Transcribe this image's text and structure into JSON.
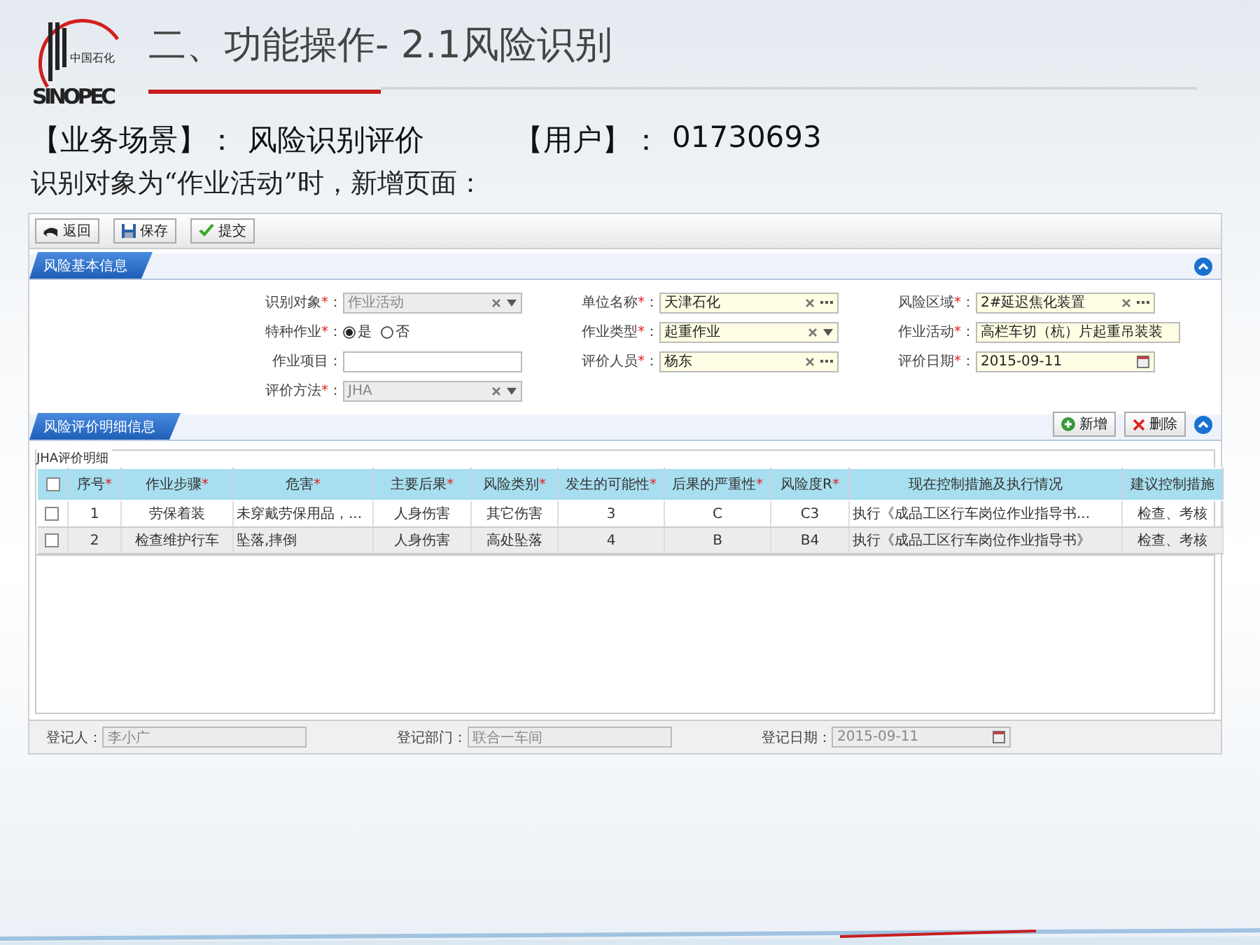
{
  "logo": {
    "text": "SINOPEC",
    "subtext": "中国石化"
  },
  "title": "二、功能操作- 2.1风险识别",
  "scenario": {
    "label": "【业务场景】",
    "sep": "：",
    "value": "风险识别评价",
    "user_label": "【用户】",
    "user_sep": "：",
    "user": "01730693"
  },
  "subtitle": "识别对象为“作业活动”时，新增页面：",
  "toolbar": [
    {
      "kind": "back",
      "label": "返回"
    },
    {
      "kind": "save",
      "label": "保存"
    },
    {
      "kind": "submit",
      "label": "提交"
    }
  ],
  "basic_panel": {
    "title": "风险基本信息",
    "expanded": true,
    "columns": [
      [
        {
          "label": "识别对象",
          "required_mark": "*",
          "colon": "：",
          "kind": "select",
          "value": "作业活动",
          "disabled": true
        },
        {
          "label": "特种作业",
          "required_mark": "*",
          "colon": "：",
          "kind": "radio",
          "options": [
            {
              "label": "是",
              "selected": true
            },
            {
              "label": "否",
              "selected": false
            }
          ]
        },
        {
          "label": "作业项目",
          "colon": "：",
          "kind": "text",
          "disabled": false
        },
        {
          "label": "评价方法",
          "required_mark": "*",
          "colon": "：",
          "kind": "select",
          "value": "JHA",
          "disabled": true
        }
      ],
      [
        {
          "label": "单位名称",
          "required_mark": "*",
          "colon": "：",
          "kind": "lookup",
          "value": "天津石化",
          "disabled": false
        },
        {
          "label": "作业类型",
          "required_mark": "*",
          "colon": "：",
          "kind": "select",
          "value": "起重作业",
          "disabled": false
        },
        {
          "label": "评价人员",
          "required_mark": "*",
          "colon": "：",
          "kind": "lookup",
          "value": "杨东",
          "disabled": false
        }
      ],
      [
        {
          "label": "风险区域",
          "required_mark": "*",
          "colon": "：",
          "kind": "lookup",
          "value": "2#延迟焦化装置",
          "disabled": false
        },
        {
          "label": "作业活动",
          "required_mark": "*",
          "colon": "：",
          "kind": "text",
          "value": "高栏车切（杭）片起重吊装装",
          "disabled": false
        },
        {
          "label": "评价日期",
          "required_mark": "*",
          "colon": "：",
          "kind": "date",
          "value": "2015-09-11",
          "disabled": false
        }
      ]
    ]
  },
  "detail_panel": {
    "title": "风险评价明细信息",
    "expanded": true,
    "buttons": [
      {
        "kind": "add",
        "label": "新增"
      },
      {
        "kind": "delete",
        "label": "删除"
      }
    ],
    "legend": "JHA评价明细",
    "table": {
      "all_checked": false,
      "columns": [
        {
          "label": "序号",
          "mark": "*"
        },
        {
          "label": "作业步骤",
          "mark": "*"
        },
        {
          "label": "危害",
          "mark": "*"
        },
        {
          "label": "主要后果",
          "mark": "*"
        },
        {
          "label": "风险类别",
          "mark": "*"
        },
        {
          "label": "发生的可能性",
          "mark": "*"
        },
        {
          "label": "后果的严重性",
          "mark": "*"
        },
        {
          "label": "风险度R",
          "mark": "*"
        },
        {
          "label": "现在控制措施及执行情况"
        },
        {
          "label": "建议控制措施"
        }
      ],
      "rows": [
        {
          "checked": false,
          "cells": [
            "1",
            "劳保着装",
            "未穿戴劳保用品，...",
            "人身伤害",
            "其它伤害",
            "3",
            "C",
            "C3",
            "执行《成品工区行车岗位作业指导书...",
            "检查、考核"
          ]
        },
        {
          "checked": false,
          "cells": [
            "2",
            "检查维护行车",
            "坠落,摔倒",
            "人身伤害",
            "高处坠落",
            "4",
            "B",
            "B4",
            "执行《成品工区行车岗位作业指导书》",
            "检查、考核"
          ]
        }
      ]
    }
  },
  "footer": [
    {
      "label": "登记人",
      "colon": "：",
      "kind": "text",
      "value": "李小广",
      "disabled": true
    },
    {
      "label": "登记部门",
      "colon": "：",
      "kind": "text",
      "value": "联合一车间",
      "disabled": true
    },
    {
      "label": "登记日期",
      "colon": "：",
      "kind": "date",
      "value": "2015-09-11",
      "disabled": true
    }
  ]
}
